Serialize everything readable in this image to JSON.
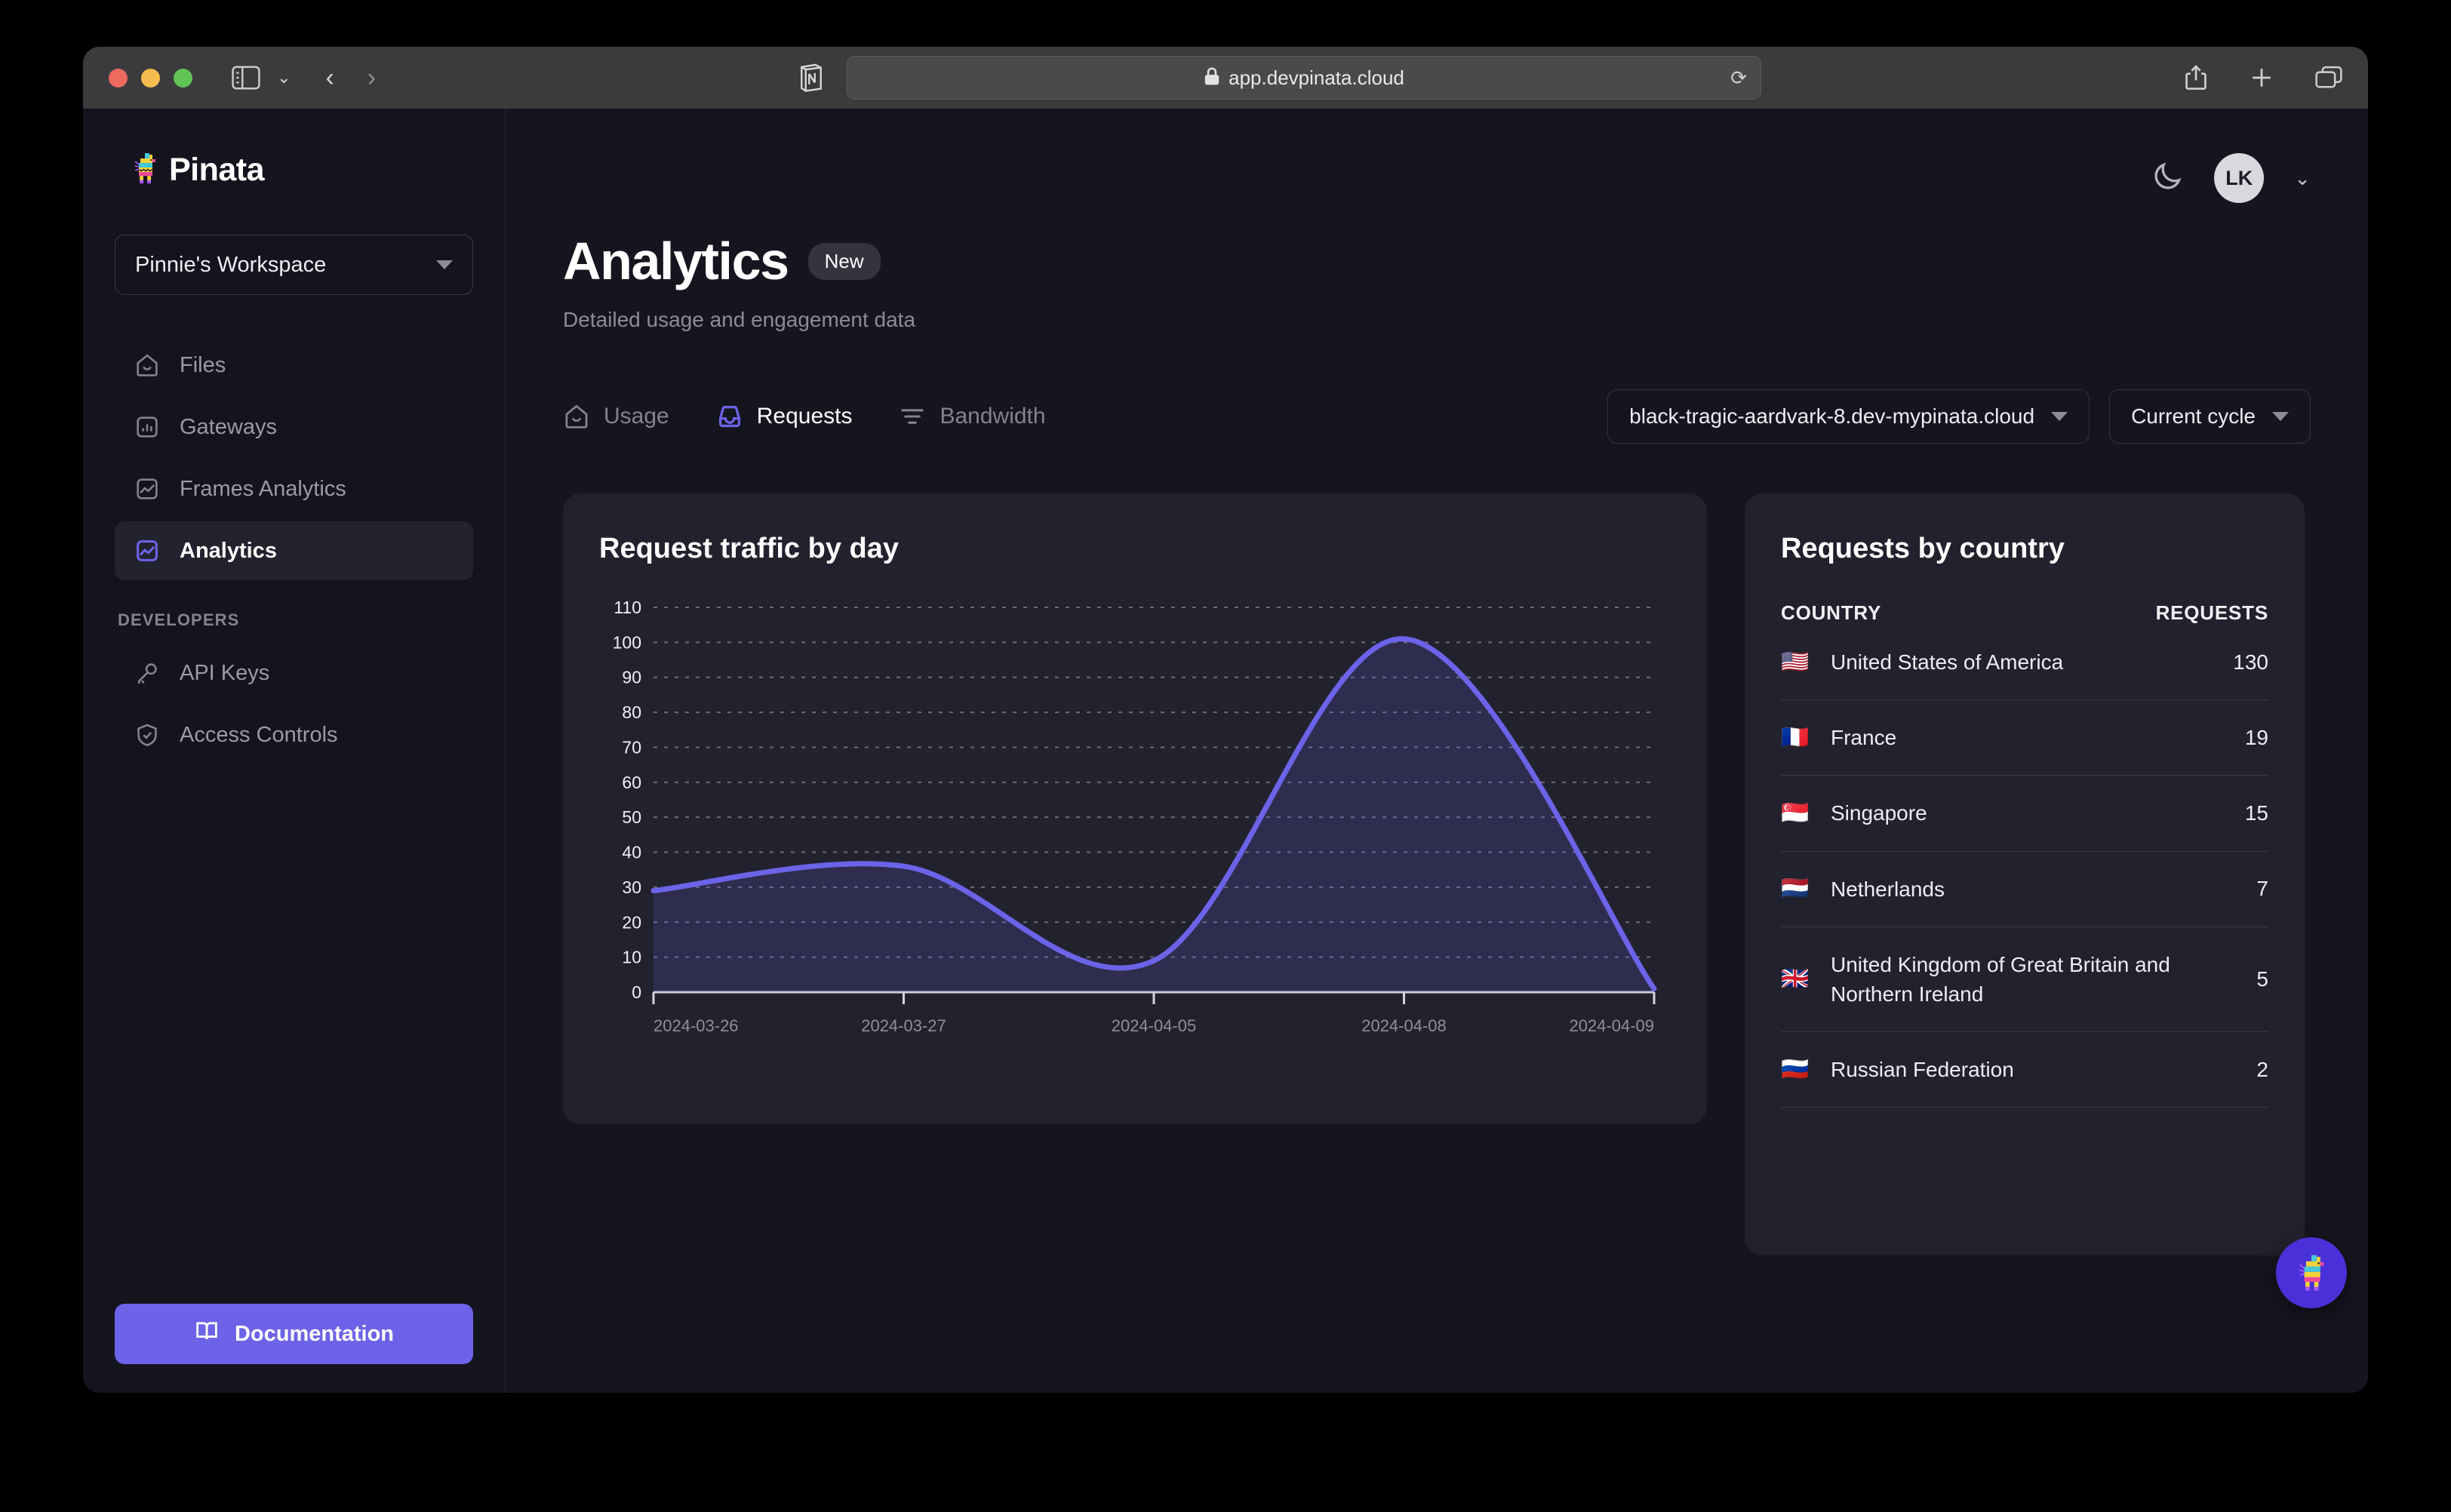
{
  "browser": {
    "url": "app.devpinata.cloud",
    "lock_icon": "lock-icon",
    "reload_icon": "reload-icon",
    "back_icon": "back-chevron-icon",
    "forward_icon": "forward-chevron-icon",
    "sidebar_toggle_icon": "sidebar-toggle-icon",
    "extension_icon": "notion-extension-icon",
    "share_icon": "share-icon",
    "newtab_icon": "plus-icon",
    "tabs_icon": "tab-overview-icon"
  },
  "sidebar": {
    "brand": "Pinata",
    "brand_icon": "pinata-logo-icon",
    "workspace": "Pinnie's Workspace",
    "items": [
      {
        "label": "Files",
        "icon": "home-files-icon",
        "active": false
      },
      {
        "label": "Gateways",
        "icon": "bar-chart-icon",
        "active": false
      },
      {
        "label": "Frames Analytics",
        "icon": "image-chart-icon",
        "active": false
      },
      {
        "label": "Analytics",
        "icon": "image-chart-icon",
        "active": true
      }
    ],
    "section_title": "DEVELOPERS",
    "dev_items": [
      {
        "label": "API Keys",
        "icon": "key-icon"
      },
      {
        "label": "Access Controls",
        "icon": "shield-check-icon"
      }
    ],
    "doc_button": "Documentation",
    "doc_icon": "book-icon"
  },
  "topbar": {
    "theme_icon": "moon-icon",
    "avatar_initials": "LK",
    "avatar_caret_icon": "chevron-down-icon"
  },
  "header": {
    "title": "Analytics",
    "badge": "New",
    "subtitle": "Detailed usage and engagement data"
  },
  "tabs": [
    {
      "label": "Usage",
      "icon": "home-usage-icon",
      "active": false
    },
    {
      "label": "Requests",
      "icon": "inbox-icon",
      "active": true
    },
    {
      "label": "Bandwidth",
      "icon": "filter-lines-icon",
      "active": false
    }
  ],
  "selects": [
    {
      "value": "black-tragic-aardvark-8.dev-mypinata.cloud",
      "caret_icon": "caret-down-icon"
    },
    {
      "value": "Current cycle",
      "caret_icon": "caret-down-icon"
    }
  ],
  "chart_card": {
    "title": "Request traffic by day"
  },
  "country_card": {
    "title": "Requests by country",
    "columns": [
      "COUNTRY",
      "REQUESTS"
    ],
    "rows": [
      {
        "flag": "🇺🇸",
        "country": "United States of America",
        "requests": "130"
      },
      {
        "flag": "🇫🇷",
        "country": "France",
        "requests": "19"
      },
      {
        "flag": "🇸🇬",
        "country": "Singapore",
        "requests": "15"
      },
      {
        "flag": "🇳🇱",
        "country": "Netherlands",
        "requests": "7"
      },
      {
        "flag": "🇬🇧",
        "country": "United Kingdom of Great Britain and Northern Ireland",
        "requests": "5"
      },
      {
        "flag": "🇷🇺",
        "country": "Russian Federation",
        "requests": "2"
      }
    ]
  },
  "fab": {
    "icon": "pinata-mascot-icon"
  },
  "colors": {
    "accent": "#6c63e8",
    "page_bg": "#15151f",
    "card_bg": "#22222e",
    "fab_bg": "#4a30d8"
  },
  "chart_data": {
    "type": "area",
    "title": "Request traffic by day",
    "xlabel": "",
    "ylabel": "",
    "ylim": [
      0,
      110
    ],
    "ytick_labels": [
      "110",
      "100",
      "90",
      "80",
      "70",
      "60",
      "50",
      "40",
      "30",
      "20",
      "10",
      "0"
    ],
    "yticks": [
      110,
      100,
      90,
      80,
      70,
      60,
      50,
      40,
      30,
      20,
      10,
      0
    ],
    "xtick_labels": [
      "2024-03-26",
      "2024-03-27",
      "2024-04-05",
      "2024-04-08",
      "2024-04-09"
    ],
    "grid": true,
    "legend": "none",
    "line_color": "#6c63e8",
    "fill_color": "rgba(108,99,232,0.18)",
    "x": [
      "2024-03-26",
      "2024-03-27",
      "2024-04-05",
      "2024-04-08",
      "2024-04-09"
    ],
    "values": [
      29,
      36,
      9,
      101,
      1
    ],
    "series": [
      {
        "name": "Requests",
        "values": [
          29,
          36,
          9,
          101,
          1
        ]
      }
    ]
  }
}
